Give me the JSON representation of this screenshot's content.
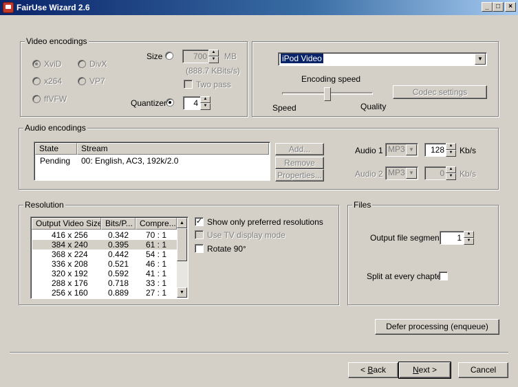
{
  "window": {
    "title": "FairUse Wizard 2.6"
  },
  "video": {
    "group_label": "Video encodings",
    "codecs": [
      {
        "label": "XviD",
        "selected": true
      },
      {
        "label": "DivX",
        "selected": false
      },
      {
        "label": "x264",
        "selected": false
      },
      {
        "label": "VP7",
        "selected": false
      },
      {
        "label": "ffVFW",
        "selected": false
      }
    ],
    "size_label": "Size",
    "size_value": "700",
    "size_unit": "MB",
    "bitrate_note": "(888.7 KBits/s)",
    "two_pass_label": "Two pass",
    "quantizer_label": "Quantizer",
    "quantizer_value": "4"
  },
  "profile": {
    "selected": "iPod Video",
    "encoding_speed_label": "Encoding speed",
    "speed_label": "Speed",
    "quality_label": "Quality",
    "codec_settings_label": "Codec settings"
  },
  "audio": {
    "group_label": "Audio encodings",
    "columns": [
      "State",
      "Stream"
    ],
    "rows": [
      {
        "state": "Pending",
        "stream": "00: English, AC3, 192k/2.0"
      }
    ],
    "add_label": "Add...",
    "remove_label": "Remove",
    "properties_label": "Properties...",
    "audio1_label": "Audio 1",
    "audio1_codec": "MP3",
    "audio1_bitrate": "128",
    "audio2_label": "Audio 2",
    "audio2_codec": "MP3",
    "audio2_bitrate": "0",
    "unit": "Kb/s"
  },
  "resolution": {
    "group_label": "Resolution",
    "columns": [
      "Output Video Size",
      "Bits/P...",
      "Compre..."
    ],
    "rows": [
      {
        "size": "416 x 256",
        "bits": "0.342",
        "ratio": "70 : 1"
      },
      {
        "size": "384 x 240",
        "bits": "0.395",
        "ratio": "61 : 1"
      },
      {
        "size": "368 x 224",
        "bits": "0.442",
        "ratio": "54 : 1"
      },
      {
        "size": "336 x 208",
        "bits": "0.521",
        "ratio": "46 : 1"
      },
      {
        "size": "320 x 192",
        "bits": "0.592",
        "ratio": "41 : 1"
      },
      {
        "size": "288 x 176",
        "bits": "0.718",
        "ratio": "33 : 1"
      },
      {
        "size": "256 x 160",
        "bits": "0.889",
        "ratio": "27 : 1"
      }
    ],
    "show_preferred_label": "Show only preferred resolutions",
    "tv_mode_label": "Use TV display mode",
    "rotate_label": "Rotate 90°"
  },
  "files": {
    "group_label": "Files",
    "segments_label": "Output file segments",
    "segments_value": "1",
    "split_label": "Split at every chapter"
  },
  "buttons": {
    "defer_label": "Defer processing (enqueue)",
    "back_prefix": "< ",
    "back_accel": "B",
    "back_rest": "ack",
    "next_accel": "N",
    "next_rest": "ext >",
    "cancel_label": "Cancel"
  }
}
